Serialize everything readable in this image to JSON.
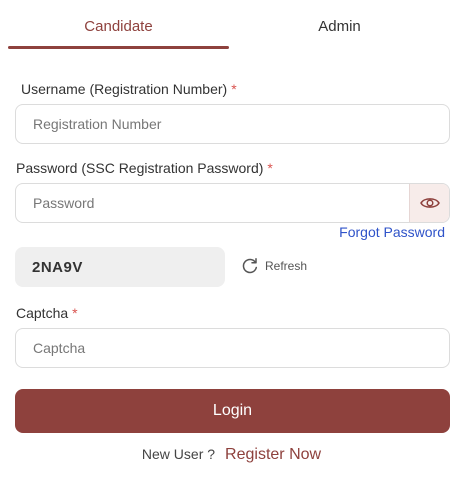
{
  "tabs": {
    "candidate": "Candidate",
    "admin": "Admin",
    "active": "Candidate"
  },
  "username": {
    "label": "Username (Registration Number)",
    "required_mark": "*",
    "placeholder": "Registration Number"
  },
  "password": {
    "label": "Password (SSC Registration Password)",
    "required_mark": "*",
    "placeholder": "Password",
    "toggle_icon": "eye-icon"
  },
  "forgot_password": "Forgot Password",
  "captcha_code": {
    "value": "2NA9V",
    "refresh_label": "Refresh",
    "refresh_icon": "refresh-icon"
  },
  "captcha": {
    "label": "Captcha",
    "required_mark": "*",
    "placeholder": "Captcha"
  },
  "login_button": "Login",
  "footer": {
    "new_user_text": "New User ?",
    "register_link": "Register Now"
  },
  "colors": {
    "brand": "#8e413d",
    "link": "#2f53c9",
    "required": "#d9534f"
  }
}
